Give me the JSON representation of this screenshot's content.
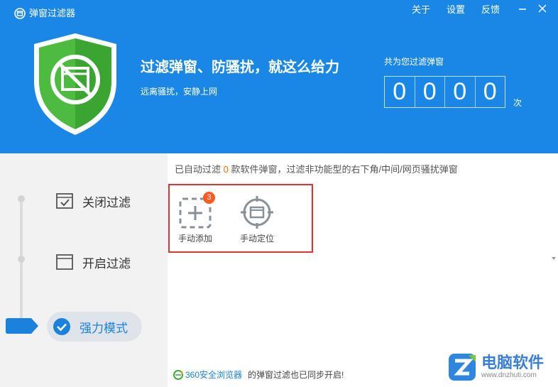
{
  "header": {
    "app_title": "弹窗过滤器",
    "links": [
      "关于",
      "设置",
      "反馈"
    ],
    "slogan": "过滤弹窗、防骚扰，就这么给力",
    "sub_slogan": "远离骚扰，安静上网",
    "counter_label": "共为您过滤弹窗",
    "counter_digits": [
      "0",
      "0",
      "0",
      "0"
    ],
    "counter_unit": "次"
  },
  "sidebar": {
    "modes": [
      {
        "label": "关闭过滤",
        "icon": "checked-window-icon"
      },
      {
        "label": "开启过滤",
        "icon": "window-icon"
      },
      {
        "label": "强力模式",
        "icon": "check-circle-icon"
      }
    ],
    "active_index": 2
  },
  "main": {
    "status_prefix": "已自动过滤",
    "status_count": "0",
    "status_suffix": "款软件弹窗，过滤非功能型的右下角/中间/网页骚扰弹窗",
    "tools": [
      {
        "label": "手动添加",
        "badge": "3",
        "icon": "dashed-plus-icon"
      },
      {
        "label": "手动定位",
        "icon": "crosshair-window-icon"
      }
    ]
  },
  "footer": {
    "browser": "360安全浏览器",
    "text": "的弹窗过滤也已同步开启!"
  },
  "watermark": {
    "title": "电脑软件",
    "url": "www.dnzhuti.com"
  },
  "colors": {
    "header_bg": "#1a87e6",
    "accent": "#1a82dc",
    "highlight_border": "#e8312f",
    "badge": "#ff5a1f",
    "shield_green": "#4cbb3f"
  }
}
